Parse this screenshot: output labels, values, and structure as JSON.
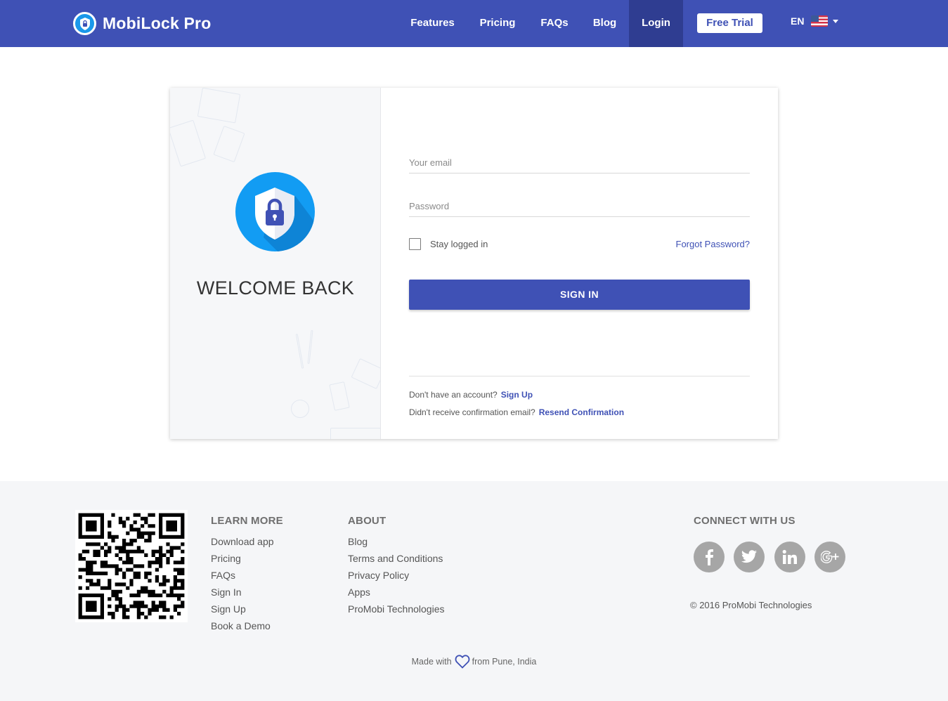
{
  "brand": {
    "name": "MobiLock Pro"
  },
  "nav": {
    "items": [
      {
        "label": "Features"
      },
      {
        "label": "Pricing"
      },
      {
        "label": "FAQs"
      },
      {
        "label": "Blog"
      },
      {
        "label": "Login"
      }
    ],
    "free_trial_label": "Free Trial",
    "language": "EN"
  },
  "login": {
    "welcome": "WELCOME BACK",
    "email_placeholder": "Your email",
    "password_placeholder": "Password",
    "remember_label": "Stay logged in",
    "forgot_label": "Forgot Password?",
    "signin_label": "SIGN IN",
    "no_account_text": "Don't have an account?",
    "signup_label": "Sign Up",
    "no_confirm_text": "Didn't receive confirmation email?",
    "resend_label": "Resend Confirmation"
  },
  "footer": {
    "learn_more": {
      "title": "LEARN MORE",
      "links": [
        "Download app",
        "Pricing",
        "FAQs",
        "Sign In",
        "Sign Up",
        "Book a Demo"
      ]
    },
    "about": {
      "title": "ABOUT",
      "links": [
        "Blog",
        "Terms and Conditions",
        "Privacy Policy",
        "Apps",
        "ProMobi Technologies"
      ]
    },
    "connect": {
      "title": "CONNECT WITH US",
      "icons": [
        "facebook-icon",
        "twitter-icon",
        "linkedin-icon",
        "google-plus-icon"
      ]
    },
    "copyright": "© 2016 ProMobi Technologies",
    "made_with": "Made with",
    "from_location": "from Pune, India"
  },
  "colors": {
    "primary": "#3f51b5",
    "primary_dark": "#2f3d91",
    "shield_blue": "#129cf3",
    "footer_bg": "#f5f6f8",
    "social_gray": "#a6a6a6"
  }
}
